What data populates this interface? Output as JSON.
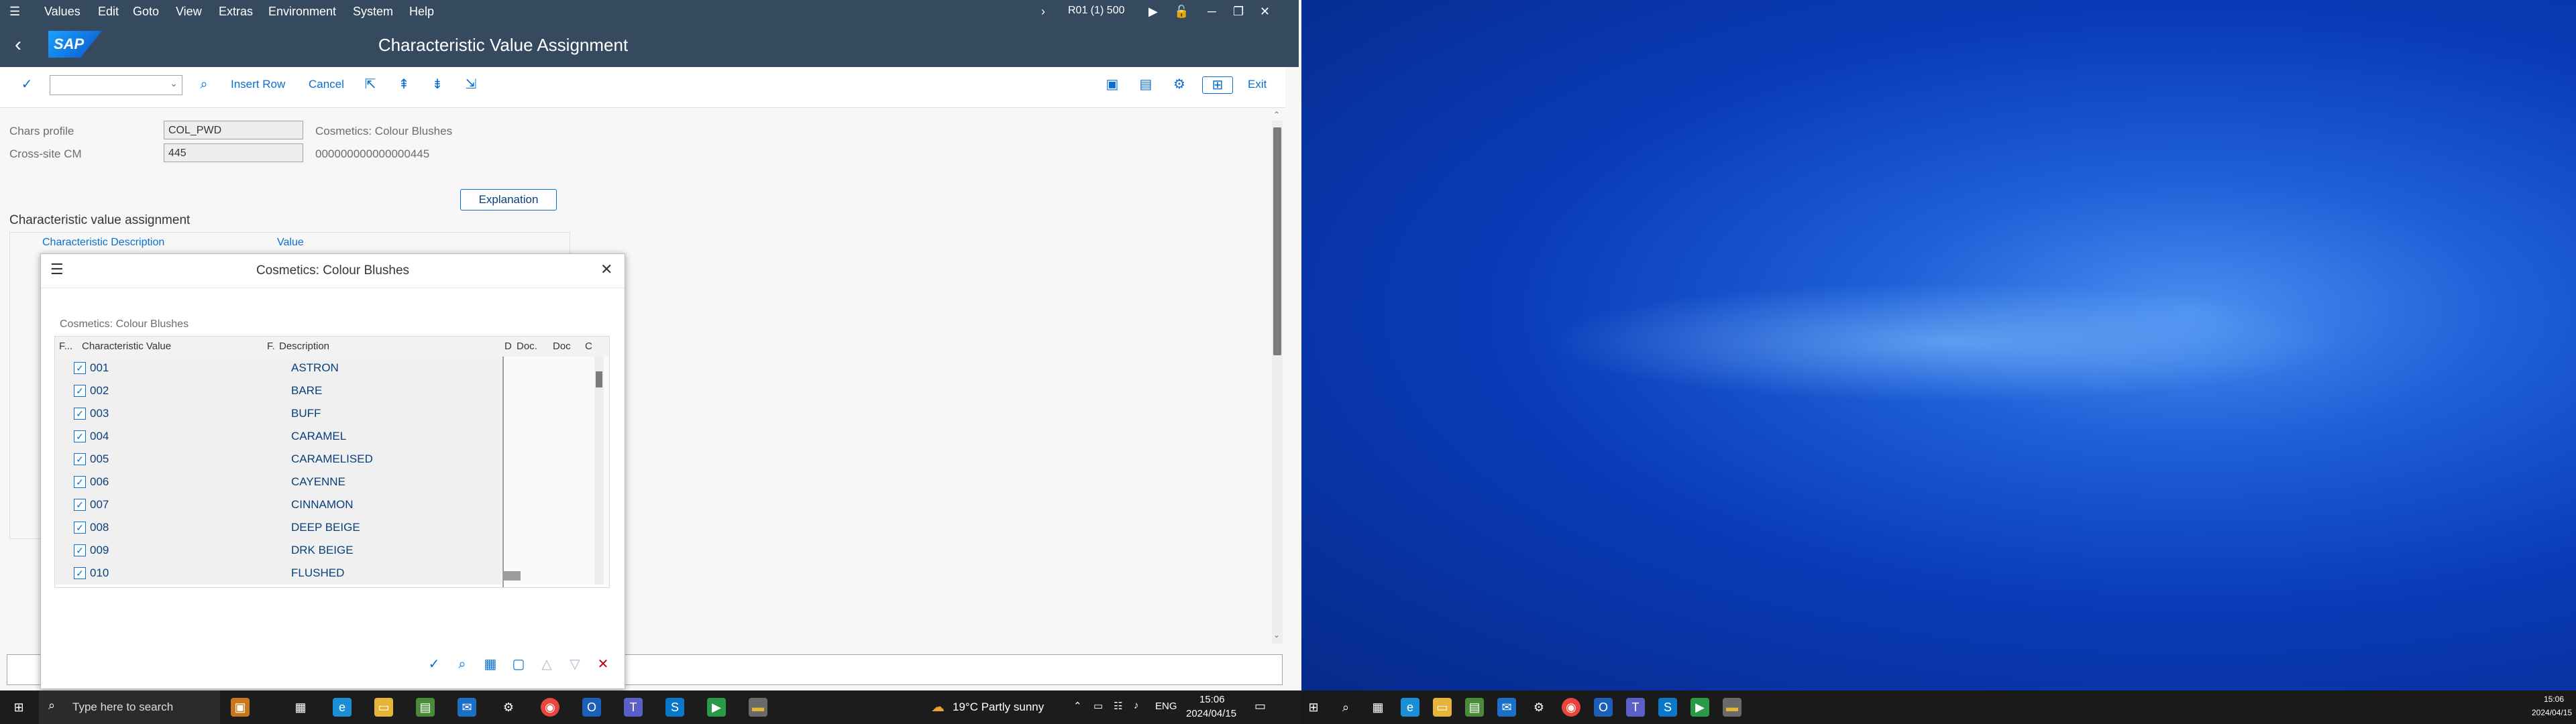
{
  "menu": [
    "Values",
    "Edit",
    "Goto",
    "View",
    "Extras",
    "Environment",
    "System",
    "Help"
  ],
  "system_info": "R01 (1) 500",
  "window_title": "Characteristic Value Assignment",
  "logo_text": "SAP",
  "toolbar": {
    "insert_row": "Insert Row",
    "cancel": "Cancel",
    "exit": "Exit"
  },
  "form": {
    "chars_profile_label": "Chars profile",
    "chars_profile_value": "COL_PWD",
    "chars_profile_desc": "Cosmetics: Colour Blushes",
    "cross_site_label": "Cross-site CM",
    "cross_site_value": "445",
    "cross_site_desc": "000000000000000445",
    "explanation_button": "Explanation",
    "section_title": "Characteristic value assignment",
    "col_char_desc": "Characteristic Description",
    "col_value": "Value"
  },
  "popup": {
    "title": "Cosmetics: Colour Blushes",
    "subtitle": "Cosmetics: Colour Blushes",
    "headers": {
      "f": "F...",
      "char_value": "Characteristic Value",
      "f2": "F.",
      "description": "Description",
      "d": "D",
      "doc1": "Doc.",
      "doc2": "Doc",
      "c": "C"
    },
    "rows": [
      {
        "value": "001",
        "desc": "ASTRON",
        "checked": true
      },
      {
        "value": "002",
        "desc": "BARE",
        "checked": true
      },
      {
        "value": "003",
        "desc": "BUFF",
        "checked": true
      },
      {
        "value": "004",
        "desc": "CARAMEL",
        "checked": true
      },
      {
        "value": "005",
        "desc": "CARAMELISED",
        "checked": true
      },
      {
        "value": "006",
        "desc": "CAYENNE",
        "checked": true
      },
      {
        "value": "007",
        "desc": "CINNAMON",
        "checked": true
      },
      {
        "value": "008",
        "desc": "DEEP BEIGE",
        "checked": true
      },
      {
        "value": "009",
        "desc": "DRK BEIGE",
        "checked": true
      },
      {
        "value": "010",
        "desc": "FLUSHED",
        "checked": true
      }
    ]
  },
  "taskbar": {
    "search_placeholder": "Type here to search",
    "weather": "19°C  Partly sunny",
    "language": "ENG",
    "time": "15:06",
    "date": "2024/04/15"
  },
  "colors": {
    "shell": "#354a5f",
    "accent": "#0a6ed1",
    "desktop": "#0a2fa8"
  }
}
